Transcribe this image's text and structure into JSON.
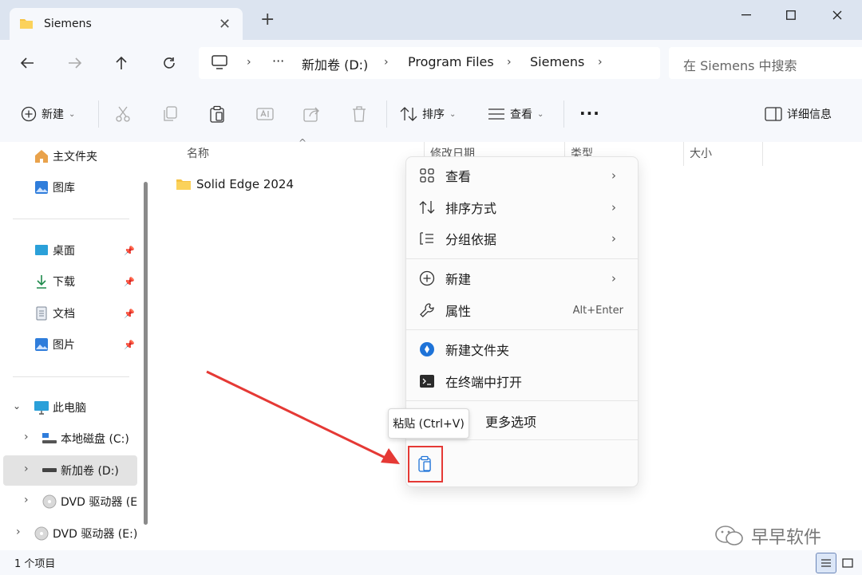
{
  "window": {
    "tab_title": "Siemens",
    "new_tab": "+",
    "minimize": "minimize",
    "maximize": "maximize",
    "close": "close"
  },
  "address": {
    "crumbs": [
      "新加卷 (D:)",
      "Program Files",
      "Siemens"
    ],
    "overflow": "···",
    "search_placeholder": "在 Siemens 中搜索"
  },
  "toolbar": {
    "new_label": "新建",
    "sort_label": "排序",
    "view_label": "查看",
    "more_label": "···",
    "details_label": "详细信息"
  },
  "sidebar": {
    "quick": [
      {
        "label": "主文件夹"
      },
      {
        "label": "图库"
      }
    ],
    "pinned": [
      {
        "label": "桌面"
      },
      {
        "label": "下载"
      },
      {
        "label": "文档"
      },
      {
        "label": "图片"
      }
    ],
    "this_pc": "此电脑",
    "drives": [
      {
        "label": "本地磁盘 (C:)"
      },
      {
        "label": "新加卷 (D:)"
      },
      {
        "label": "DVD 驱动器 (E"
      },
      {
        "label": "DVD 驱动器 (E:)"
      }
    ]
  },
  "columns": {
    "name": "名称",
    "modified": "修改日期",
    "type": "类型",
    "size": "大小"
  },
  "files": [
    {
      "name": "Solid Edge 2024"
    }
  ],
  "context_menu": {
    "items": [
      {
        "label": "查看",
        "icon": "grid-view-icon"
      },
      {
        "label": "排序方式",
        "icon": "sort-icon"
      },
      {
        "label": "分组依据",
        "icon": "group-icon"
      },
      {
        "label": "新建",
        "icon": "plus-circle-icon"
      },
      {
        "label": "属性",
        "accel": "Alt+Enter",
        "icon": "wrench-icon"
      },
      {
        "label": "新建文件夹",
        "icon": "new-folder-icon"
      },
      {
        "label": "在终端中打开",
        "icon": "terminal-icon"
      },
      {
        "label": "更多选项",
        "icon": "more-options-icon"
      }
    ],
    "paste_tooltip": "粘贴 (Ctrl+V)"
  },
  "status": {
    "count": "1 个项目"
  },
  "watermark": "早早软件",
  "colors": {
    "accent": "#0067c0",
    "highlight": "#e53935",
    "folder": "#f6c344"
  }
}
